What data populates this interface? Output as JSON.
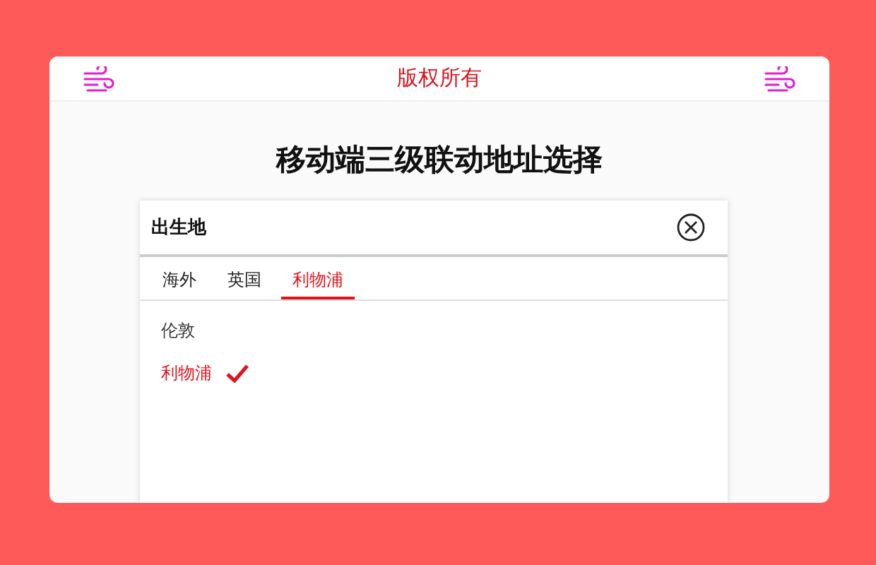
{
  "header": {
    "title": "版权所有"
  },
  "heading": "移动端三级联动地址选择",
  "picker": {
    "title": "出生地",
    "tabs": [
      {
        "label": "海外",
        "selected": false
      },
      {
        "label": "英国",
        "selected": false
      },
      {
        "label": "利物浦",
        "selected": true
      }
    ],
    "options": [
      {
        "label": "伦敦",
        "selected": false
      },
      {
        "label": "利物浦",
        "selected": true
      }
    ]
  }
}
